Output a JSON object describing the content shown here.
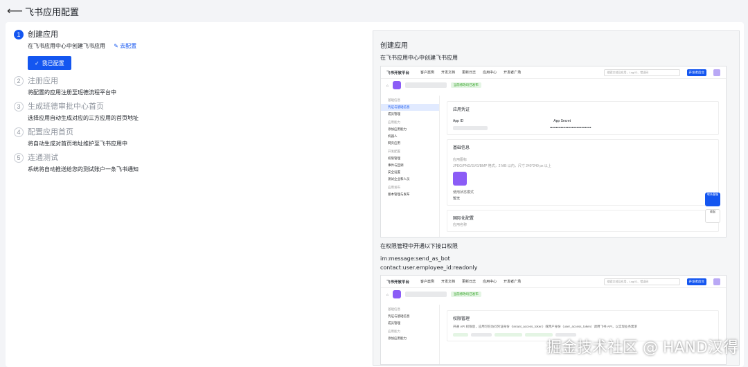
{
  "header": {
    "title": "飞书应用配置"
  },
  "steps": [
    {
      "num": "1",
      "title": "创建应用",
      "desc": "在飞书应用中心中创建飞书应用",
      "link": "去配置",
      "button": "我已配置"
    },
    {
      "num": "2",
      "title": "注册应用",
      "desc": "将配置的应用注册至班德流程平台中"
    },
    {
      "num": "3",
      "title": "生成班德审批中心首页",
      "desc": "选择应用自动生成对应的三方应用的首页地址"
    },
    {
      "num": "4",
      "title": "配置应用首页",
      "desc": "将自动生成对首页地址维护至飞书应用中"
    },
    {
      "num": "5",
      "title": "连通测试",
      "desc": "系统将自动推送给您的测试账户一条飞书通知"
    }
  ],
  "preview": {
    "title": "创建应用",
    "subtitle": "在飞书应用中心中创建飞书应用",
    "perm_text": "在权限管理中开通以下接口权限",
    "perm_lines": [
      "im:message:send_as_bot",
      "contact:user.employee_id:readonly"
    ],
    "shot": {
      "brand": "飞书开放平台",
      "nav": [
        "客户案例",
        "开发文档",
        "更新日志",
        "应用中心",
        "开发者广场"
      ],
      "search_placeholder": "搜索文档及应用，Log ID、错误码",
      "create": "开发者后台",
      "status": "当前修改均已发布",
      "side_groups": [
        "基础信息",
        "应用能力",
        "开发配置",
        "应用发布"
      ],
      "side_items": [
        "凭证与基础信息",
        "成员管理",
        "添加应用能力",
        "机器人",
        "网页应用",
        "权限管理",
        "事件与回调",
        "安全设置",
        "测试企业和人员",
        "版本管理与发布"
      ],
      "card1": "应用凭证",
      "card1_app_id": "App ID",
      "card1_secret": "App Secret",
      "card2": "基础信息",
      "card2_icon": "应用图标",
      "card2_spec": "JPEG/PNG/SVG/BMP 格式，2 MB 以内，尺寸 240*240 px 以上",
      "card2_mode": "使用状态模式",
      "card2_mode_val": "暂无",
      "card3": "国际化配置",
      "card3_sub": "应用名称",
      "float1": "联系客服",
      "float2": "收起"
    },
    "shot2": {
      "card": "权限管理",
      "desc": "开通 API 权限后，应用可在访问凭证身份（tenant_access_token）或用户身份（user_access_token）调用飞书 API，以实现业务需求"
    }
  },
  "watermark": "掘金技术社区 @ HAND汉得"
}
